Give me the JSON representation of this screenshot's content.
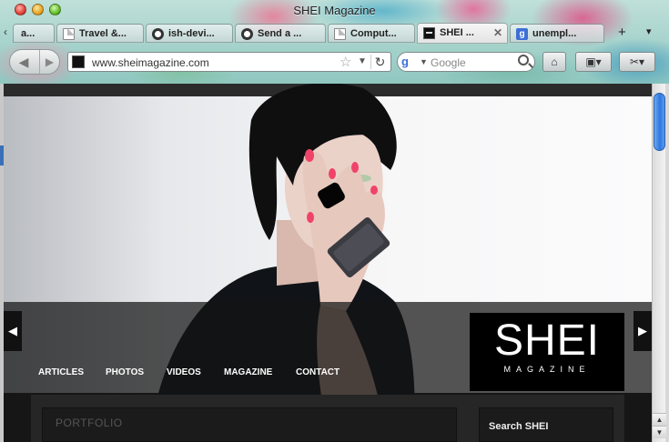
{
  "window": {
    "title": "SHEI Magazine"
  },
  "tabs": [
    {
      "label": "a...",
      "icon": "document-icon"
    },
    {
      "label": "Travel &...",
      "icon": "document-icon"
    },
    {
      "label": "ish-devi...",
      "icon": "github-icon"
    },
    {
      "label": "Send a ...",
      "icon": "github-icon"
    },
    {
      "label": "Comput...",
      "icon": "document-icon"
    },
    {
      "label": "SHEI ...",
      "icon": "shei-favicon",
      "active": true
    },
    {
      "label": "unempl...",
      "icon": "google-icon"
    }
  ],
  "tabbar": {
    "new_tab": "+",
    "tab_list": "▾",
    "scroll_left": "‹"
  },
  "navbar": {
    "url": "www.sheimagazine.com",
    "search_placeholder": "Google",
    "search_engine_glyph": "g",
    "back_glyph": "◀",
    "forward_glyph": "▶",
    "reload_glyph": "↻",
    "star_glyph": "☆",
    "dropdown_glyph": "▼",
    "home_glyph": "⌂",
    "bookmarks_glyph": "▣▾",
    "tools_glyph": "✂▾"
  },
  "site": {
    "logo_main": "SHEI",
    "logo_sub": "MAGAZINE",
    "menu": [
      "ARTICLES",
      "PHOTOS",
      "VIDEOS",
      "MAGAZINE",
      "CONTACT"
    ],
    "slider_prev": "◀",
    "slider_next": "▶",
    "portfolio_label": "PORTFOLIO",
    "search_widget_title": "Search SHEI"
  },
  "scrollbar": {
    "up_glyph": "▲",
    "down_glyph": "▼"
  },
  "colors": {
    "accent": "#2c78df",
    "site_dark": "#1e1e1e"
  }
}
